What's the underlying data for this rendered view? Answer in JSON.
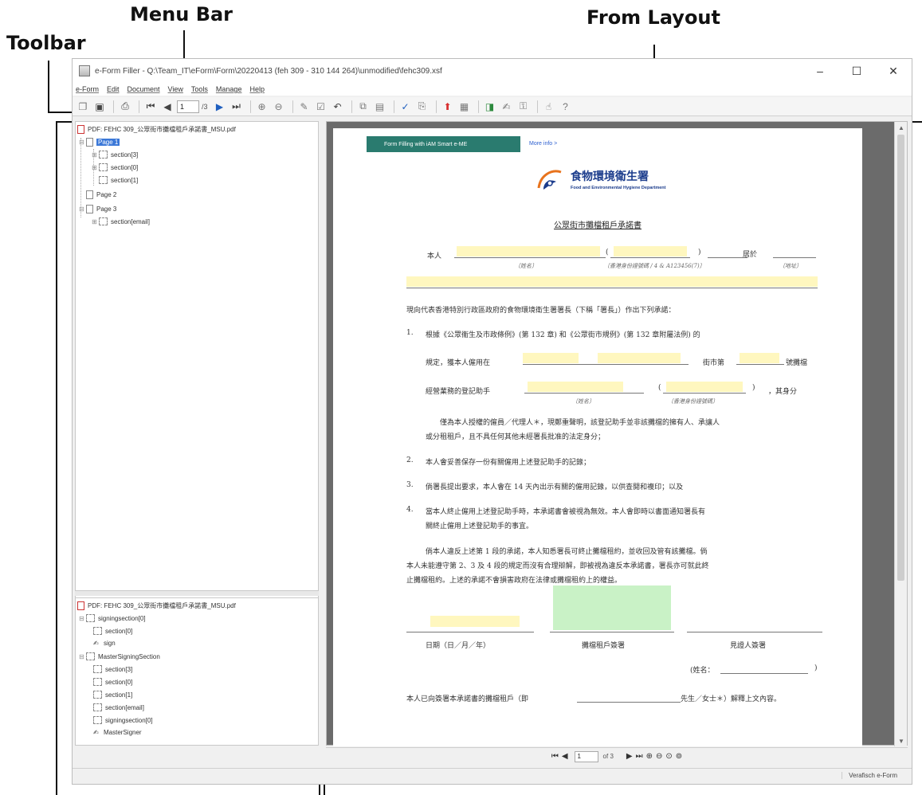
{
  "annotations": {
    "menu_bar": "Menu Bar",
    "toolbar": "Toolbar",
    "form_layout": "From Layout"
  },
  "window": {
    "title": "e-Form Filler - Q:\\Team_IT\\eForm\\Form\\20220413 (feh 309 - 310 144 264)\\unmodified\\fehc309.xsf",
    "minimize": "–",
    "maximize": "☐",
    "close": "✕"
  },
  "menu": [
    "e-Form",
    "Edit",
    "Document",
    "View",
    "Tools",
    "Manage",
    "Help"
  ],
  "toolbar": {
    "current_page": "1",
    "page_count": "/3"
  },
  "tree_top": {
    "file": "PDF: FEHC 309_公眾街市攤檔租戶承諾書_MSU.pdf",
    "nodes": [
      {
        "label": "Page 1"
      },
      {
        "label": "section[3]"
      },
      {
        "label": "section[0]"
      },
      {
        "label": "section[1]"
      },
      {
        "label": "Page 2"
      },
      {
        "label": "Page 3"
      },
      {
        "label": "section[email]"
      }
    ]
  },
  "tree_bottom": {
    "file": "PDF: FEHC 309_公眾街市攤檔租戶承諾書_MSU.pdf",
    "nodes": [
      {
        "label": "signingsection[0]"
      },
      {
        "label": "section[0]"
      },
      {
        "label": "sign"
      },
      {
        "label": "MasterSigningSection"
      },
      {
        "label": "section[3]"
      },
      {
        "label": "section[0]"
      },
      {
        "label": "section[1]"
      },
      {
        "label": "section[email]"
      },
      {
        "label": "signingsection[0]"
      },
      {
        "label": "MasterSigner"
      }
    ]
  },
  "document": {
    "banner": "Form Filling with iAM Smart e-ME",
    "more_info": "More info >",
    "logo_zh": "食物環境衛生署",
    "logo_en": "Food and Environmental Hygiene Department",
    "title": "公眾街市攤檔租戶承諾書",
    "line_me": "本人",
    "line_me_paren_open": "(",
    "line_me_paren_close": ")",
    "line_me_residing": "居於",
    "label_name": "〔姓名〕",
    "label_id": "〔香港身份證號碼 / 4 & A123456(7)〕",
    "label_address": "〔地址〕",
    "para_intro": "現向代表香港特別行政區政府的食物環境衛生署署長（下稱「署長」）作出下列承諾：",
    "item1_num": "1.",
    "item1_text": "根據《公眾衞生及市政條例》(第 132 章) 和《公眾街市規例》(第 132 章附屬法例) 的",
    "item1_line2_a": "規定，獲本人僱用在",
    "item1_line2_b": "街市第",
    "item1_line2_c": "號攤檔",
    "item1_line3_a": "經營業務的登記助手",
    "item1_line3_paren_open": "(",
    "item1_line3_paren_close": ")",
    "item1_line3_b": "，其身分",
    "label_name2": "〔姓名〕",
    "label_id2": "〔香港身份證號碼〕",
    "item1_line4": "僅為本人授權的僱員／代理人＊，現鄭重聲明，該登記助手並非該攤檔的擁有人、承讓人",
    "item1_line5": "或分租租戶，且不具任何其他未經署長批准的法定身分；",
    "item2_num": "2.",
    "item2_text": "本人會妥善保存一份有關僱用上述登記助手的記錄；",
    "item3_num": "3.",
    "item3_text": "倘署長提出要求，本人會在 14 天內出示有關的僱用記錄，以供查閱和複印；以及",
    "item4_num": "4.",
    "item4_text": "當本人終止僱用上述登記助手時，本承諾書會被視為無效。本人會即時以書面通知署長有",
    "item4_text2": "關終止僱用上述登記助手的事宜。",
    "para_breach1": "倘本人違反上述第 1 段的承諾，本人知悉署長可終止攤檔租約，並收回及管有該攤檔。倘",
    "para_breach2": "本人未能遵守第 2、3 及 4 段的規定而沒有合理辯解，即被視為違反本承諾書，署長亦可就此終",
    "para_breach3": "止攤檔租約。上述的承諾不會損害政府在法律或攤檔租約上的權益。",
    "sig_date": "日期（日／月／年）",
    "sig_tenant": "攤檔租戶簽署",
    "sig_witness": "見證人簽署",
    "witness_name": "(姓名：",
    "witness_name_close": ")",
    "footer_line_a": "本人已向簽署本承諾書的攤檔租戶（即",
    "footer_line_b": "先生／女士＊）解釋上文內容。"
  },
  "doc_nav": {
    "page": "1",
    "of": "of 3"
  },
  "status": {
    "vendor": "Verafisch e-Form"
  }
}
